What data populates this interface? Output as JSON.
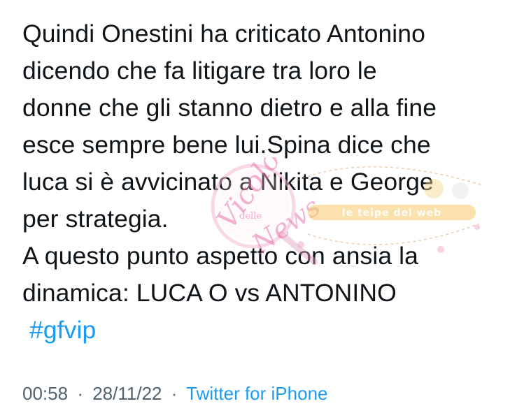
{
  "tweet": {
    "lines": [
      "Quindi Onestini ha criticato Antonino",
      "dicendo che fa litigare tra loro le",
      "donne che gli stanno dietro e alla fine",
      "esce sempre bene lui.Spina dice che",
      "luca si è avvicinato a Nikita e George",
      "per strategia.",
      "A questo punto aspetto con ansia la",
      "dinamica: LUCA O vs ANTONINO"
    ],
    "hashtag": "#gfvip"
  },
  "meta": {
    "time": "00:58",
    "date": "28/11/22",
    "separator": "·",
    "source": "Twitter for iPhone"
  },
  "watermark": {
    "script_text": "Vicolo delle News",
    "banner_text": "le teipe del web"
  },
  "colors": {
    "text": "#0f1419",
    "link": "#1d9bf0",
    "meta": "#536471",
    "watermark_pink": "#e86aa8"
  }
}
